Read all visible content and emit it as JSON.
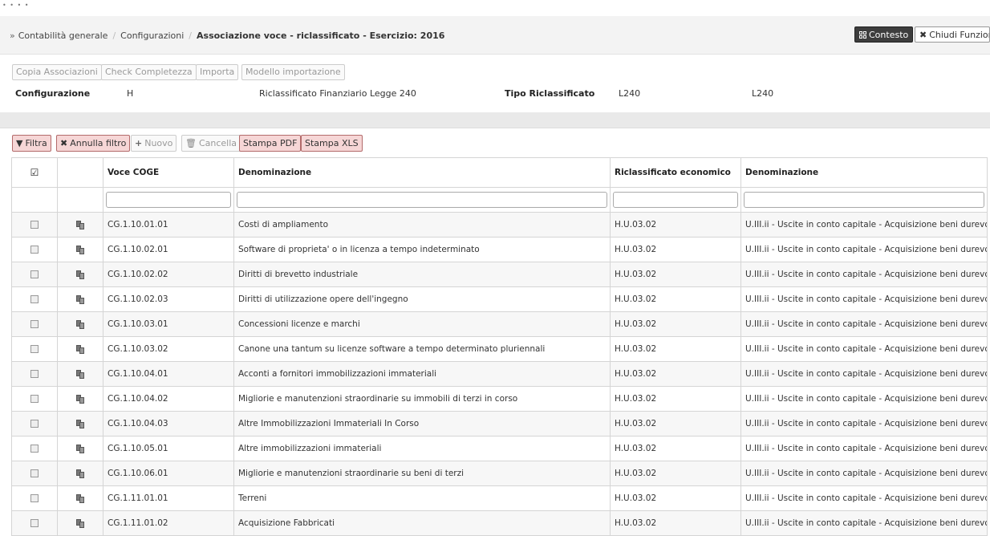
{
  "header": {
    "breadcrumb": [
      "Contabilità generale",
      "Configurazioni",
      "Associazione voce - riclassificato - Esercizio: 2016"
    ],
    "contesto_label": "Contesto",
    "chiudi_label": "Chiudi Funzion"
  },
  "info": {
    "buttons": [
      "Copia Associazioni",
      "Check Completezza",
      "Importa",
      "Modello importazione"
    ],
    "configurazione_label": "Configurazione",
    "configurazione_code": "H",
    "configurazione_desc": "Riclassificato Finanziario Legge 240",
    "tipo_label": "Tipo Riclassificato",
    "tipo_value1": "L240",
    "tipo_value2": "L240"
  },
  "toolbar": {
    "filtra": "Filtra",
    "annulla_filtro": "Annulla filtro",
    "nuovo": "Nuovo",
    "cancella": "Cancella",
    "stampa_pdf": "Stampa PDF",
    "stampa_xls": "Stampa XLS"
  },
  "table": {
    "columns": [
      "Voce COGE",
      "Denominazione",
      "Riclassificato economico",
      "Denominazione"
    ],
    "rows": [
      {
        "voce": "CG.1.10.01.01",
        "denominazione": "Costi di ampliamento",
        "ricl": "H.U.03.02",
        "den2": "U.III.ii - Uscite in conto capitale - Acquisizione beni durevoli"
      },
      {
        "voce": "CG.1.10.02.01",
        "denominazione": "Software di proprieta' o in licenza a tempo indeterminato",
        "ricl": "H.U.03.02",
        "den2": "U.III.ii - Uscite in conto capitale - Acquisizione beni durevoli"
      },
      {
        "voce": "CG.1.10.02.02",
        "denominazione": "Diritti di brevetto industriale",
        "ricl": "H.U.03.02",
        "den2": "U.III.ii - Uscite in conto capitale - Acquisizione beni durevoli"
      },
      {
        "voce": "CG.1.10.02.03",
        "denominazione": "Diritti di utilizzazione opere dell'ingegno",
        "ricl": "H.U.03.02",
        "den2": "U.III.ii - Uscite in conto capitale - Acquisizione beni durevoli"
      },
      {
        "voce": "CG.1.10.03.01",
        "denominazione": "Concessioni licenze e marchi",
        "ricl": "H.U.03.02",
        "den2": "U.III.ii - Uscite in conto capitale - Acquisizione beni durevoli"
      },
      {
        "voce": "CG.1.10.03.02",
        "denominazione": "Canone una tantum su licenze software a tempo determinato pluriennali",
        "ricl": "H.U.03.02",
        "den2": "U.III.ii - Uscite in conto capitale - Acquisizione beni durevoli"
      },
      {
        "voce": "CG.1.10.04.01",
        "denominazione": "Acconti a fornitori immobilizzazioni immateriali",
        "ricl": "H.U.03.02",
        "den2": "U.III.ii - Uscite in conto capitale - Acquisizione beni durevoli"
      },
      {
        "voce": "CG.1.10.04.02",
        "denominazione": "Migliorie e manutenzioni straordinarie su immobili di terzi in corso",
        "ricl": "H.U.03.02",
        "den2": "U.III.ii - Uscite in conto capitale - Acquisizione beni durevoli"
      },
      {
        "voce": "CG.1.10.04.03",
        "denominazione": "Altre Immobilizzazioni Immateriali In Corso",
        "ricl": "H.U.03.02",
        "den2": "U.III.ii - Uscite in conto capitale - Acquisizione beni durevoli"
      },
      {
        "voce": "CG.1.10.05.01",
        "denominazione": "Altre immobilizzazioni immateriali",
        "ricl": "H.U.03.02",
        "den2": "U.III.ii - Uscite in conto capitale - Acquisizione beni durevoli"
      },
      {
        "voce": "CG.1.10.06.01",
        "denominazione": "Migliorie e manutenzioni straordinarie su beni di terzi",
        "ricl": "H.U.03.02",
        "den2": "U.III.ii - Uscite in conto capitale - Acquisizione beni durevoli"
      },
      {
        "voce": "CG.1.11.01.01",
        "denominazione": "Terreni",
        "ricl": "H.U.03.02",
        "den2": "U.III.ii - Uscite in conto capitale - Acquisizione beni durevoli"
      },
      {
        "voce": "CG.1.11.01.02",
        "denominazione": "Acquisizione Fabbricati",
        "ricl": "H.U.03.02",
        "den2": "U.III.ii - Uscite in conto capitale - Acquisizione beni durevoli"
      }
    ]
  }
}
